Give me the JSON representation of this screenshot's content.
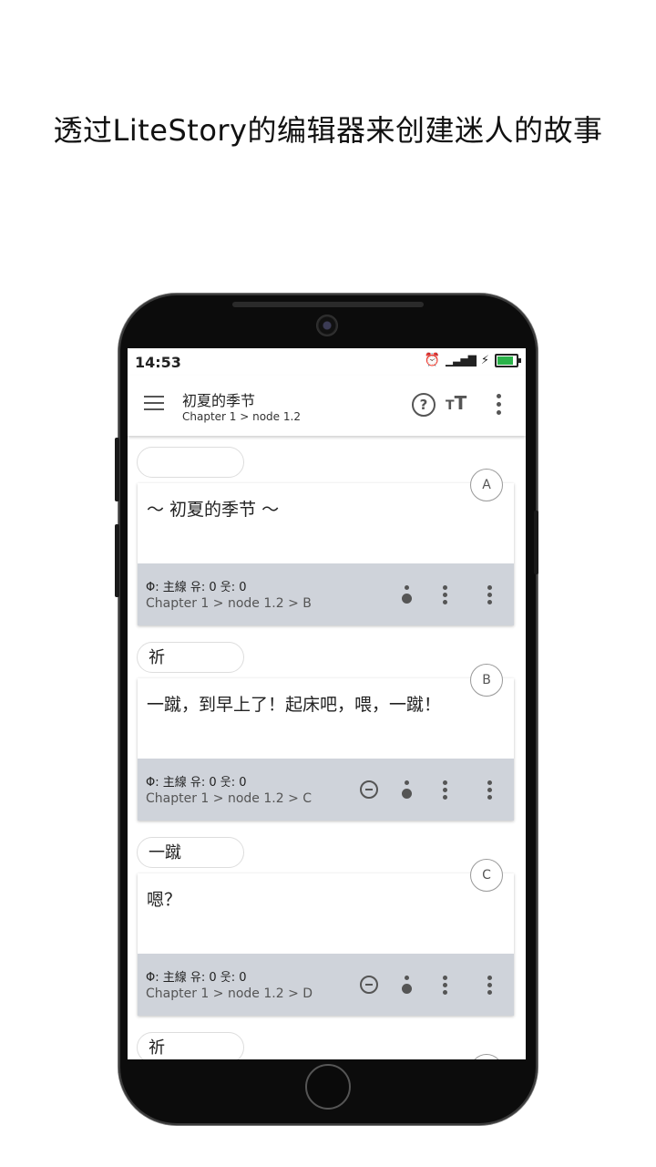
{
  "headline": "透过LiteStory的编辑器来创建迷人的故事",
  "status": {
    "time": "14:53"
  },
  "appbar": {
    "title": "初夏的季节",
    "subtitle": "Chapter 1 > node 1.2"
  },
  "cards": [
    {
      "badge": "A",
      "speaker": "",
      "text": "～ 初夏的季节 ～",
      "meta": "Φ: 主線   유: 0   웃: 0",
      "path": "Chapter 1 > node 1.2 > B"
    },
    {
      "badge": "B",
      "speaker": "祈",
      "text": "一蹴，到早上了！起床吧，喂，一蹴！",
      "meta": "Φ: 主線   유: 0   웃: 0",
      "path": "Chapter 1 > node 1.2 > C"
    },
    {
      "badge": "C",
      "speaker": "一蹴",
      "text": "嗯？",
      "meta": "Φ: 主線   유: 0   웃: 0",
      "path": "Chapter 1 > node 1.2 > D"
    }
  ],
  "next_speaker": "祈",
  "icons": [
    "menu-icon",
    "help-icon",
    "text-size-icon",
    "more-vert-icon",
    "remove-circle-icon",
    "pin-icon"
  ],
  "colors": {
    "footer": "#cfd3da",
    "battery": "#2bb34a"
  }
}
